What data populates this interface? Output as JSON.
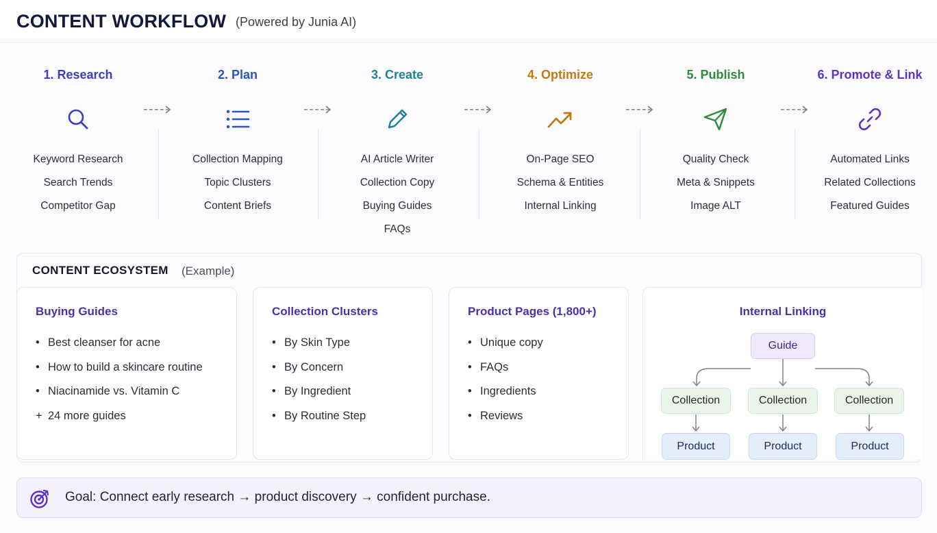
{
  "header": {
    "title": "CONTENT WORKFLOW",
    "subtitle": "(Powered by Junia AI)"
  },
  "steps": [
    {
      "title": "1. Research",
      "color": "#3d3dc4",
      "icon": "search-icon",
      "items": [
        "Keyword Research",
        "Search Trends",
        "Competitor Gap"
      ]
    },
    {
      "title": "2. Plan",
      "color": "#2456c9",
      "icon": "list-icon",
      "items": [
        "Collection Mapping",
        "Topic Clusters",
        "Content Briefs"
      ]
    },
    {
      "title": "3. Create",
      "color": "#1f8296",
      "icon": "pencil-icon",
      "items": [
        "AI Article Writer",
        "Collection Copy",
        "Buying Guides",
        "FAQs"
      ]
    },
    {
      "title": "4. Optimize",
      "color": "#c07a12",
      "icon": "trending-up-icon",
      "items": [
        "On-Page SEO",
        "Schema & Entities",
        "Internal Linking"
      ]
    },
    {
      "title": "5. Publish",
      "color": "#2f8a3e",
      "icon": "send-icon",
      "items": [
        "Quality Check",
        "Meta & Snippets",
        "Image ALT"
      ]
    },
    {
      "title": "6. Promote & Link",
      "color": "#5b32c8",
      "icon": "link-icon",
      "items": [
        "Automated Links",
        "Related Collections",
        "Featured Guides"
      ]
    }
  ],
  "ecosystem": {
    "title": "CONTENT ECOSYSTEM",
    "subtitle": "(Example)",
    "cards": [
      {
        "title": "Buying Guides",
        "items": [
          {
            "bullet": "•",
            "text": "Best cleanser for acne"
          },
          {
            "bullet": "•",
            "text": "How to build a skincare routine"
          },
          {
            "bullet": "•",
            "text": "Niacinamide vs. Vitamin C"
          },
          {
            "bullet": "+",
            "text": "24 more guides"
          }
        ]
      },
      {
        "title": "Collection Clusters",
        "items": [
          {
            "bullet": "•",
            "text": "By Skin Type"
          },
          {
            "bullet": "•",
            "text": "By Concern"
          },
          {
            "bullet": "•",
            "text": "By Ingredient"
          },
          {
            "bullet": "•",
            "text": "By Routine Step"
          }
        ]
      },
      {
        "title": "Product Pages (1,800+)",
        "items": [
          {
            "bullet": "•",
            "text": "Unique copy"
          },
          {
            "bullet": "•",
            "text": "FAQs"
          },
          {
            "bullet": "•",
            "text": "Ingredients"
          },
          {
            "bullet": "•",
            "text": "Reviews"
          }
        ]
      }
    ],
    "linking": {
      "title": "Internal Linking",
      "guide": "Guide",
      "collections": [
        "Collection",
        "Collection",
        "Collection"
      ],
      "products": [
        "Product",
        "Product",
        "Product"
      ]
    }
  },
  "goal": {
    "icon": "target-icon",
    "text": "Goal: Connect early research → product discovery → confident purchase."
  }
}
